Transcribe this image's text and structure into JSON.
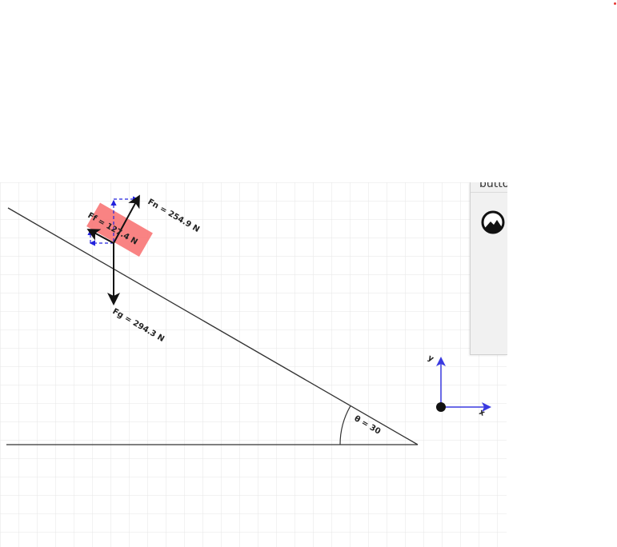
{
  "diagram": {
    "angle_label": "θ = 30",
    "forces": {
      "normal": "Fn = 254.9 N",
      "friction": "Ff = 127.4 N",
      "gravity": "Fg = 294.3 N"
    },
    "axes": {
      "y_label": "y",
      "x_label": "x"
    },
    "colors": {
      "block": "#f97c7c",
      "force_arrow": "#111111",
      "component_dashes": "#2222dd",
      "axis_arrow": "#3a3ae0"
    }
  },
  "panel": {
    "button_label": "butto",
    "icon": "mountain-icon"
  }
}
